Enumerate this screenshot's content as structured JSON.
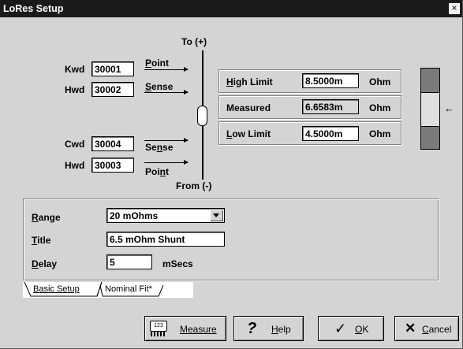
{
  "window": {
    "title": "LoRes Setup",
    "close_glyph": "×"
  },
  "diagram": {
    "top_label": "To (+)",
    "bottom_label": "From (-)",
    "kwd": {
      "label": "Kwd",
      "value": "30001",
      "wire": "Point"
    },
    "hwd1": {
      "label": "Hwd",
      "value": "30002",
      "wire": "Sense"
    },
    "cwd": {
      "label": "Cwd",
      "value": "30004",
      "wire": "Sense"
    },
    "hwd2": {
      "label": "Hwd",
      "value": "30003",
      "wire": "Point"
    }
  },
  "limits": {
    "high": {
      "label": "High Limit",
      "value": "8.5000m",
      "unit": "Ohm"
    },
    "measured": {
      "label": "Measured",
      "value": "6.6583m",
      "unit": "Ohm"
    },
    "low": {
      "label": "Low Limit",
      "value": "4.5000m",
      "unit": "Ohm"
    },
    "indicator_arrow": "←"
  },
  "setup": {
    "range": {
      "label": "Range",
      "value": "20 mOhms"
    },
    "title": {
      "label": "Title",
      "value": "6.5 mOhm Shunt"
    },
    "delay": {
      "label": "Delay",
      "value": "5",
      "unit": "mSecs"
    }
  },
  "tabs": [
    {
      "label": "Basic Setup",
      "active": true
    },
    {
      "label": "Nominal Fit*",
      "active": false
    }
  ],
  "buttons": {
    "measure": {
      "label": "Measure",
      "icon": "calculator-icon",
      "icon_text": "123"
    },
    "help": {
      "label": "Help",
      "icon": "question-icon"
    },
    "ok": {
      "label": "OK",
      "icon": "checkmark-icon"
    },
    "cancel": {
      "label": "Cancel",
      "icon": "x-icon"
    }
  }
}
